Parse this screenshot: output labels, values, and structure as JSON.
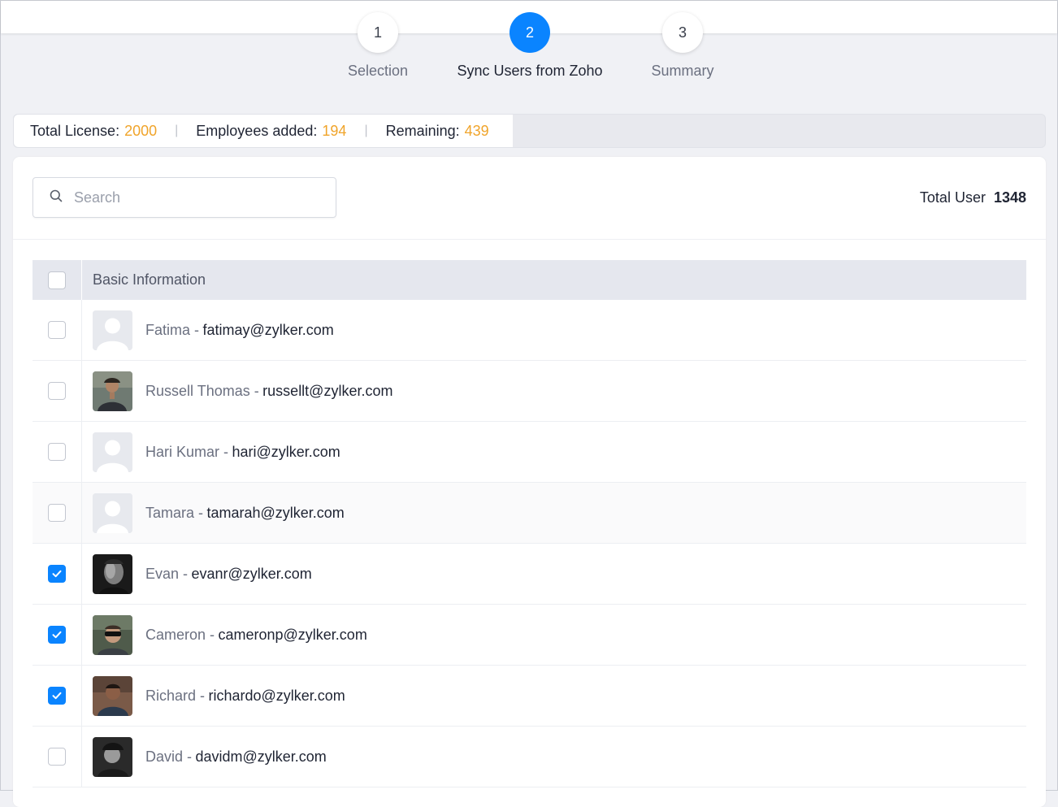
{
  "stepper": {
    "steps": [
      {
        "number": "1",
        "label": "Selection"
      },
      {
        "number": "2",
        "label": "Sync Users from Zoho"
      },
      {
        "number": "3",
        "label": "Summary"
      }
    ]
  },
  "license": {
    "total_label": "Total License:",
    "total_value": "2000",
    "added_label": "Employees added:",
    "added_value": "194",
    "remaining_label": "Remaining:",
    "remaining_value": "439",
    "separator": "|"
  },
  "search": {
    "placeholder": "Search"
  },
  "total_user": {
    "label": "Total User",
    "value": "1348"
  },
  "table": {
    "header": "Basic Information",
    "rows": [
      {
        "name": "Fatima -",
        "email": "fatimay@zylker.com"
      },
      {
        "name": "Russell Thomas -",
        "email": "russellt@zylker.com"
      },
      {
        "name": "Hari Kumar -",
        "email": "hari@zylker.com"
      },
      {
        "name": "Tamara -",
        "email": "tamarah@zylker.com"
      },
      {
        "name": "Evan -",
        "email": "evanr@zylker.com"
      },
      {
        "name": "Cameron -",
        "email": "cameronp@zylker.com"
      },
      {
        "name": "Richard -",
        "email": "richardo@zylker.com"
      },
      {
        "name": "David -",
        "email": "davidm@zylker.com"
      }
    ]
  },
  "colors": {
    "accent": "#0a84ff",
    "highlight": "#f0a42a"
  }
}
